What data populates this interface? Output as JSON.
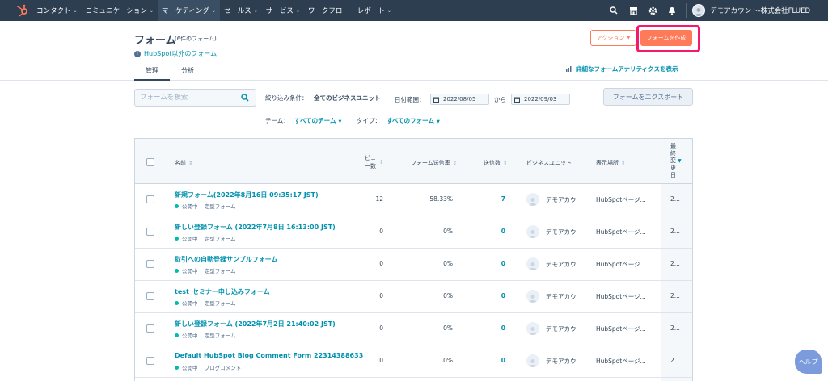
{
  "nav": {
    "items": [
      {
        "label": "コンタクト",
        "dropdown": true
      },
      {
        "label": "コミュニケーション",
        "dropdown": true
      },
      {
        "label": "マーケティング",
        "dropdown": true,
        "active": true
      },
      {
        "label": "セールス",
        "dropdown": true
      },
      {
        "label": "サービス",
        "dropdown": true
      },
      {
        "label": "ワークフロー",
        "dropdown": false
      },
      {
        "label": "レポート",
        "dropdown": true
      }
    ],
    "account": "デモアカウント-株式会社FLUED",
    "brand_color": "#ff7a59",
    "bg_color": "#2d3e50"
  },
  "header": {
    "title": "フォーム",
    "count": "(6件のフォーム)",
    "external_link": "HubSpot以外のフォーム",
    "tabs": [
      {
        "label": "管理",
        "active": true
      },
      {
        "label": "分析",
        "active": false
      }
    ],
    "action_button": "アクション",
    "create_button": "フォームを作成",
    "analytics_link": "詳細なフォームアナリティクスを表示"
  },
  "filters": {
    "search_placeholder": "フォームを検索",
    "narrow_label": "絞り込み条件：",
    "narrow_value": "全てのビジネスユニット",
    "date_label": "日付範囲：",
    "date_from": "2022/08/05",
    "date_sep": "から",
    "date_to": "2022/09/03",
    "export_button": "フォームをエクスポート",
    "team_label": "チーム：",
    "team_value": "すべてのチーム",
    "type_label": "タイプ：",
    "type_value": "すべてのフォーム"
  },
  "table": {
    "headers": {
      "name": "名前",
      "views": "ビュー数",
      "rate": "フォーム送信率",
      "submissions": "送信数",
      "business_unit": "ビジネスユニット",
      "location": "表示場所",
      "last_modified": "最終変更日"
    },
    "rows": [
      {
        "name": "新規フォーム(2022年8月16日 09:35:17 JST)",
        "status": "公開中",
        "type": "定型フォーム",
        "views": "12",
        "rate": "58.33%",
        "submissions": "7",
        "business_unit": "デモアカウ",
        "location": "HubSpotページ...",
        "modified": "2..."
      },
      {
        "name": "新しい登録フォーム (2022年7月8日 16:13:00 JST)",
        "status": "公開中",
        "type": "定型フォーム",
        "views": "0",
        "rate": "0%",
        "submissions": "0",
        "business_unit": "デモアカウ",
        "location": "HubSpotページ...",
        "modified": "2..."
      },
      {
        "name": "取引への自動登録サンプルフォーム",
        "status": "公開中",
        "type": "定型フォーム",
        "views": "0",
        "rate": "0%",
        "submissions": "0",
        "business_unit": "デモアカウ",
        "location": "HubSpotページ...",
        "modified": "2..."
      },
      {
        "name": "test_セミナー申し込みフォーム",
        "status": "公開中",
        "type": "定型フォーム",
        "views": "0",
        "rate": "0%",
        "submissions": "0",
        "business_unit": "デモアカウ",
        "location": "HubSpotページ...",
        "modified": "2..."
      },
      {
        "name": "新しい登録フォーム (2022年7月2日 21:40:02 JST)",
        "status": "公開中",
        "type": "定型フォーム",
        "views": "0",
        "rate": "0%",
        "submissions": "0",
        "business_unit": "デモアカウ",
        "location": "HubSpotページ...",
        "modified": "2..."
      },
      {
        "name": "Default HubSpot Blog Comment Form 22314388633",
        "status": "公開中",
        "type": "ブログコメント",
        "views": "0",
        "rate": "0%",
        "submissions": "0",
        "business_unit": "デモアカウ",
        "location": "HubSpotページ...",
        "modified": "2..."
      }
    ]
  },
  "help_button": "ヘルプ"
}
